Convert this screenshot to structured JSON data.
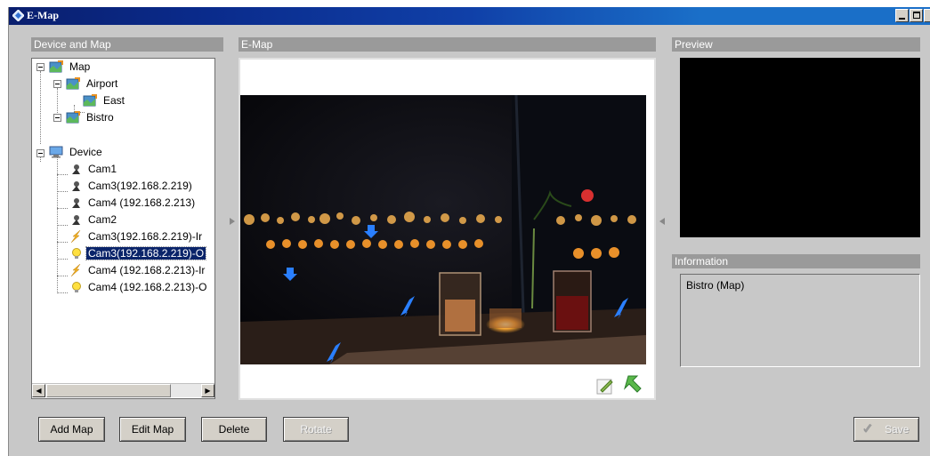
{
  "window": {
    "title": "E-Map"
  },
  "panels": {
    "device_and_map": "Device and Map",
    "emap": "E-Map",
    "preview": "Preview",
    "information": "Information"
  },
  "tree": {
    "map": "Map",
    "airport": "Airport",
    "east": "East",
    "bistro": "Bistro",
    "device": "Device",
    "devices": [
      "Cam1",
      "Cam3(192.168.2.219)",
      "Cam4 (192.168.2.213)",
      "Cam2",
      "Cam3(192.168.2.219)-Ir",
      "Cam3(192.168.2.219)-O",
      "Cam4 (192.168.2.213)-Ir",
      "Cam4 (192.168.2.213)-O"
    ],
    "selected_index": 5
  },
  "information": {
    "text": "Bistro (Map)"
  },
  "buttons": {
    "add_map": "Add Map",
    "edit_map": "Edit Map",
    "delete": "Delete",
    "rotate": "Rotate",
    "save": "Save"
  },
  "colors": {
    "title_bar": "#0a2a8a",
    "selection": "#0a246a",
    "device_marker": "#2a7fff"
  }
}
